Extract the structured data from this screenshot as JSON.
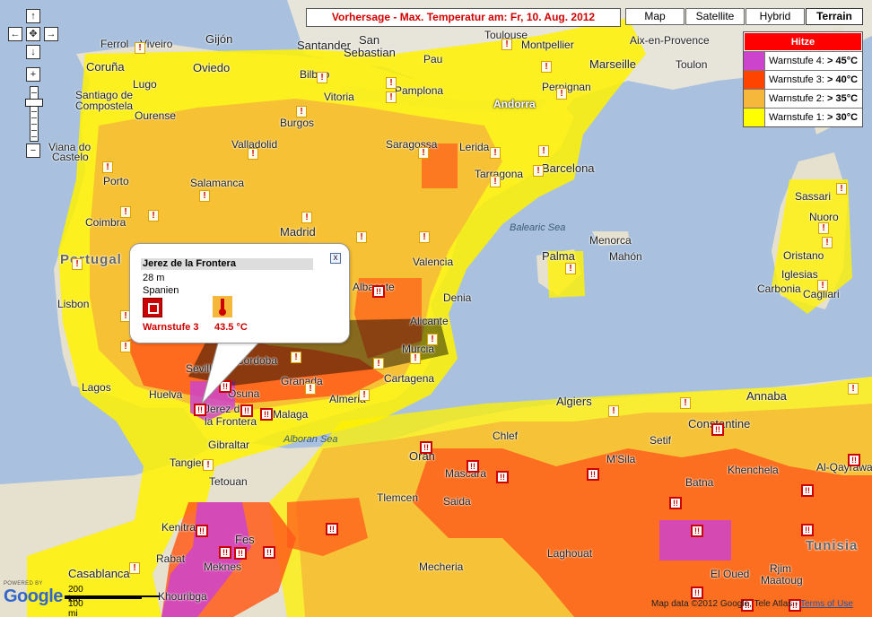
{
  "title": "Vorhersage - Max. Temperatur am: Fr, 10. Aug. 2012",
  "map_types": [
    "Map",
    "Satellite",
    "Hybrid",
    "Terrain"
  ],
  "map_type_active": "Terrain",
  "legend": {
    "header": "Hitze",
    "rows": [
      {
        "label": "Warnstufe 4:",
        "threshold": "> 45°C",
        "color": "#cc44cc"
      },
      {
        "label": "Warnstufe 3:",
        "threshold": "> 40°C",
        "color": "#ff4400"
      },
      {
        "label": "Warnstufe 2:",
        "threshold": "> 35°C",
        "color": "#f5b83a"
      },
      {
        "label": "Warnstufe 1:",
        "threshold": "> 30°C",
        "color": "#ffff00"
      }
    ]
  },
  "nav": {
    "up": "↑",
    "down": "↓",
    "left": "←",
    "right": "→",
    "center": "✥",
    "zoom_in": "+",
    "zoom_out": "−"
  },
  "info_window": {
    "city": "Jerez de la Frontera",
    "elevation": "28 m",
    "country": "Spanien",
    "warning": "Warnstufe 3",
    "temperature": "43.5  °C",
    "close": "x"
  },
  "places": [
    {
      "name": "Ferrol"
    },
    {
      "name": "Viveiro"
    },
    {
      "name": "Gijón"
    },
    {
      "name": "Santander"
    },
    {
      "name": "San"
    },
    {
      "name": "Sebastian"
    },
    {
      "name": "Toulouse"
    },
    {
      "name": "Montpellier"
    },
    {
      "name": "Aix-en-Provence"
    },
    {
      "name": "Coruña"
    },
    {
      "name": "Oviedo"
    },
    {
      "name": "Bilbao"
    },
    {
      "name": "Pau"
    },
    {
      "name": "Marseille"
    },
    {
      "name": "Toulon"
    },
    {
      "name": "Lugo"
    },
    {
      "name": "Santiago de"
    },
    {
      "name": "Compostela"
    },
    {
      "name": "Vitoria"
    },
    {
      "name": "Pamplona"
    },
    {
      "name": "Andorra"
    },
    {
      "name": "Perpignan"
    },
    {
      "name": "Ourense"
    },
    {
      "name": "Burgos"
    },
    {
      "name": "Viana do"
    },
    {
      "name": "Castelo"
    },
    {
      "name": "Valladolid"
    },
    {
      "name": "Saragossa"
    },
    {
      "name": "Lerida"
    },
    {
      "name": "Barcelona"
    },
    {
      "name": "Porto"
    },
    {
      "name": "Salamanca"
    },
    {
      "name": "Tarragona"
    },
    {
      "name": "Coimbra"
    },
    {
      "name": "Madrid"
    },
    {
      "name": "Balearic Sea"
    },
    {
      "name": "Menorca"
    },
    {
      "name": "Mahón"
    },
    {
      "name": "Sassari"
    },
    {
      "name": "Nuoro"
    },
    {
      "name": "Portugal"
    },
    {
      "name": "Valencia"
    },
    {
      "name": "Palma"
    },
    {
      "name": "Oristano"
    },
    {
      "name": "Iglesias"
    },
    {
      "name": "Carbonia"
    },
    {
      "name": "Cagliari"
    },
    {
      "name": "Albacete"
    },
    {
      "name": "Lisbon"
    },
    {
      "name": "Denia"
    },
    {
      "name": "Alicante"
    },
    {
      "name": "Murcia"
    },
    {
      "name": "Seville"
    },
    {
      "name": "Cordoba"
    },
    {
      "name": "Granada"
    },
    {
      "name": "Cartagena"
    },
    {
      "name": "Lagos"
    },
    {
      "name": "Huelva"
    },
    {
      "name": "Osuna"
    },
    {
      "name": "Almeria"
    },
    {
      "name": "Jerez de"
    },
    {
      "name": "la Frontera"
    },
    {
      "name": "Malaga"
    },
    {
      "name": "Algiers"
    },
    {
      "name": "Annaba"
    },
    {
      "name": "Alboran Sea"
    },
    {
      "name": "Gibraltar"
    },
    {
      "name": "Chlef"
    },
    {
      "name": "Setif"
    },
    {
      "name": "Constantine"
    },
    {
      "name": "Tangier"
    },
    {
      "name": "Oran"
    },
    {
      "name": "M'Sila"
    },
    {
      "name": "Tetouan"
    },
    {
      "name": "Mascara"
    },
    {
      "name": "Batna"
    },
    {
      "name": "Saida"
    },
    {
      "name": "Khenchela"
    },
    {
      "name": "Al-Qayrawan"
    },
    {
      "name": "Tlemcen"
    },
    {
      "name": "Kenitra"
    },
    {
      "name": "Rabat"
    },
    {
      "name": "Fes"
    },
    {
      "name": "Tunisia"
    },
    {
      "name": "Laghouat"
    },
    {
      "name": "Meknes"
    },
    {
      "name": "Casablanca"
    },
    {
      "name": "Mecheria"
    },
    {
      "name": "El Oued"
    },
    {
      "name": "Rjim"
    },
    {
      "name": "Maatoug"
    },
    {
      "name": "Khouribga"
    }
  ],
  "scale": {
    "km": "200 km",
    "mi": "100 mi"
  },
  "logo": {
    "powered_by": "POWERED BY",
    "name": "Google"
  },
  "copyright": {
    "text": "Map data ©2012 Google, Tele Atlas - ",
    "link": "Terms of Use"
  }
}
